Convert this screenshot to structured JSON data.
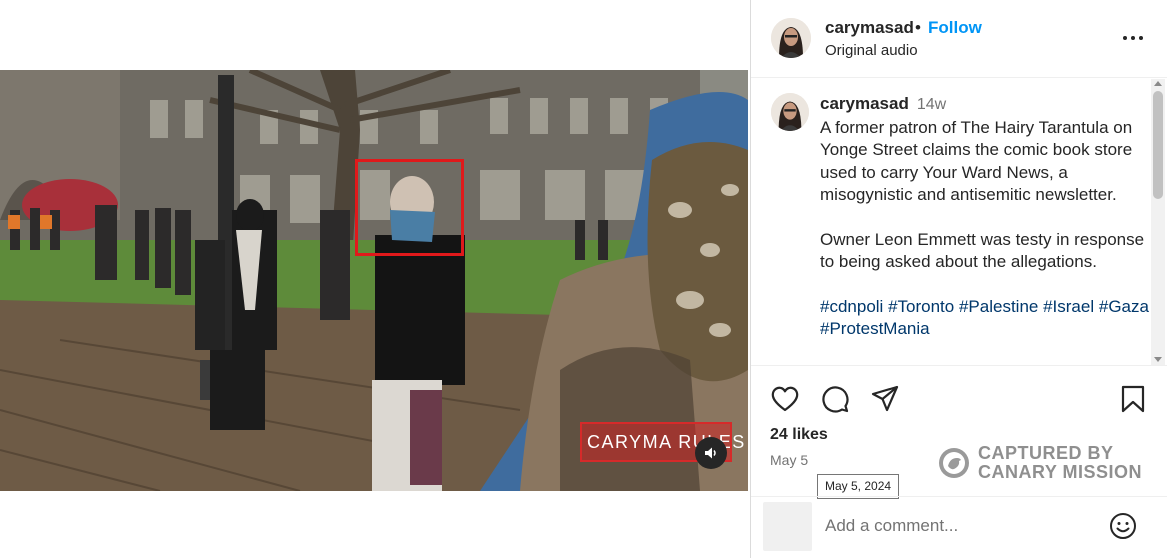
{
  "post": {
    "username": "carymasad",
    "follow_label": "Follow",
    "separator": "•",
    "audio_label": "Original audio",
    "more_icon": "more-horizontal-icon"
  },
  "media": {
    "watermark_text": "CARYMA RULES",
    "mute_icon": "speaker-icon",
    "highlight_color": "#e0191b"
  },
  "caption": {
    "username": "carymasad",
    "time_ago": "14w",
    "paragraph1": "A former patron of The Hairy Tarantula on Yonge Street claims the comic book store used to carry Your Ward News, a misogynistic and antisemitic newsletter.",
    "paragraph2": "Owner Leon Emmett was testy in response to being asked about the allegations.",
    "hashtags": [
      "#cdnpoli",
      "#Toronto",
      "#Palestine",
      "#Israel",
      "#Gaza",
      "#ProtestMania"
    ]
  },
  "actions": {
    "icons": [
      "heart-icon",
      "comment-icon",
      "share-icon",
      "bookmark-icon"
    ],
    "likes_text": "24 likes",
    "date_text": "May 5",
    "date_tooltip": "May 5, 2024"
  },
  "stamp": {
    "line1": "CAPTURED BY",
    "line2": "CANARY MISSION"
  },
  "comment": {
    "placeholder": "Add a comment...",
    "emoji_icon": "smiley-icon"
  },
  "colors": {
    "follow_blue": "#0095f6",
    "hashtag_blue": "#00376b",
    "secondary_gray": "#737373"
  }
}
